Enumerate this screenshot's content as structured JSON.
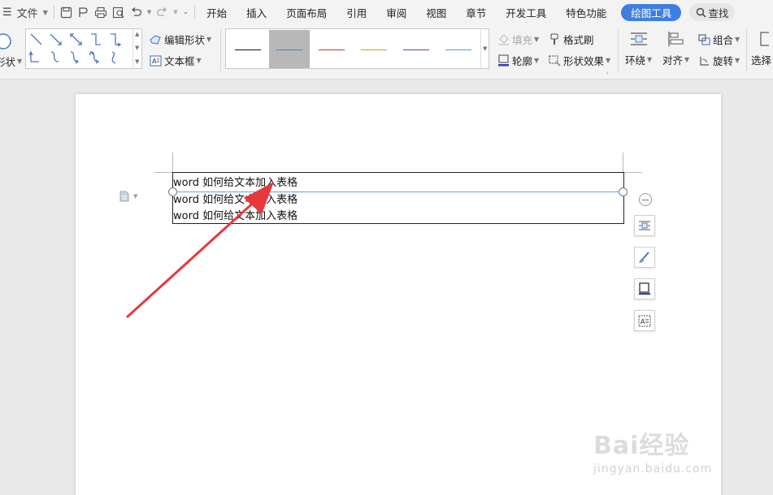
{
  "menubar": {
    "file_label": "文件",
    "tabs": [
      {
        "label": "开始"
      },
      {
        "label": "插入"
      },
      {
        "label": "页面布局"
      },
      {
        "label": "引用"
      },
      {
        "label": "审阅"
      },
      {
        "label": "视图"
      },
      {
        "label": "章节"
      },
      {
        "label": "开发工具"
      },
      {
        "label": "特色功能"
      }
    ],
    "active_tab": "绘图工具",
    "search_label": "查找",
    "accent_color": "#3d7ee0"
  },
  "ribbon": {
    "shape_label_partial": "形状",
    "edit_shape_label": "编辑形状",
    "text_box_label": "文本框",
    "fill_label": "填充",
    "format_painter_label": "格式刷",
    "outline_label": "轮廓",
    "shape_effects_label": "形状效果",
    "wrap_label": "环绕",
    "align_label": "对齐",
    "group_label": "组合",
    "rotate_label": "旋转",
    "select_label_partial": "选择",
    "line_styles": [
      {
        "color": "#111111"
      },
      {
        "color": "#4a78c2"
      },
      {
        "color": "#c0392b"
      },
      {
        "color": "#c9a227"
      },
      {
        "color": "#7a3c8c"
      },
      {
        "color": "#4aa3d8"
      }
    ]
  },
  "document": {
    "rows": [
      {
        "text": "word 如何给文本加入表格"
      },
      {
        "text": "word 如何给文本加入表格"
      },
      {
        "text": "word 如何给文本加入表格"
      }
    ],
    "arrow_color": "#e8393a"
  },
  "watermark": {
    "brand": "Bai经验",
    "url": "jingyan.baidu.com"
  }
}
